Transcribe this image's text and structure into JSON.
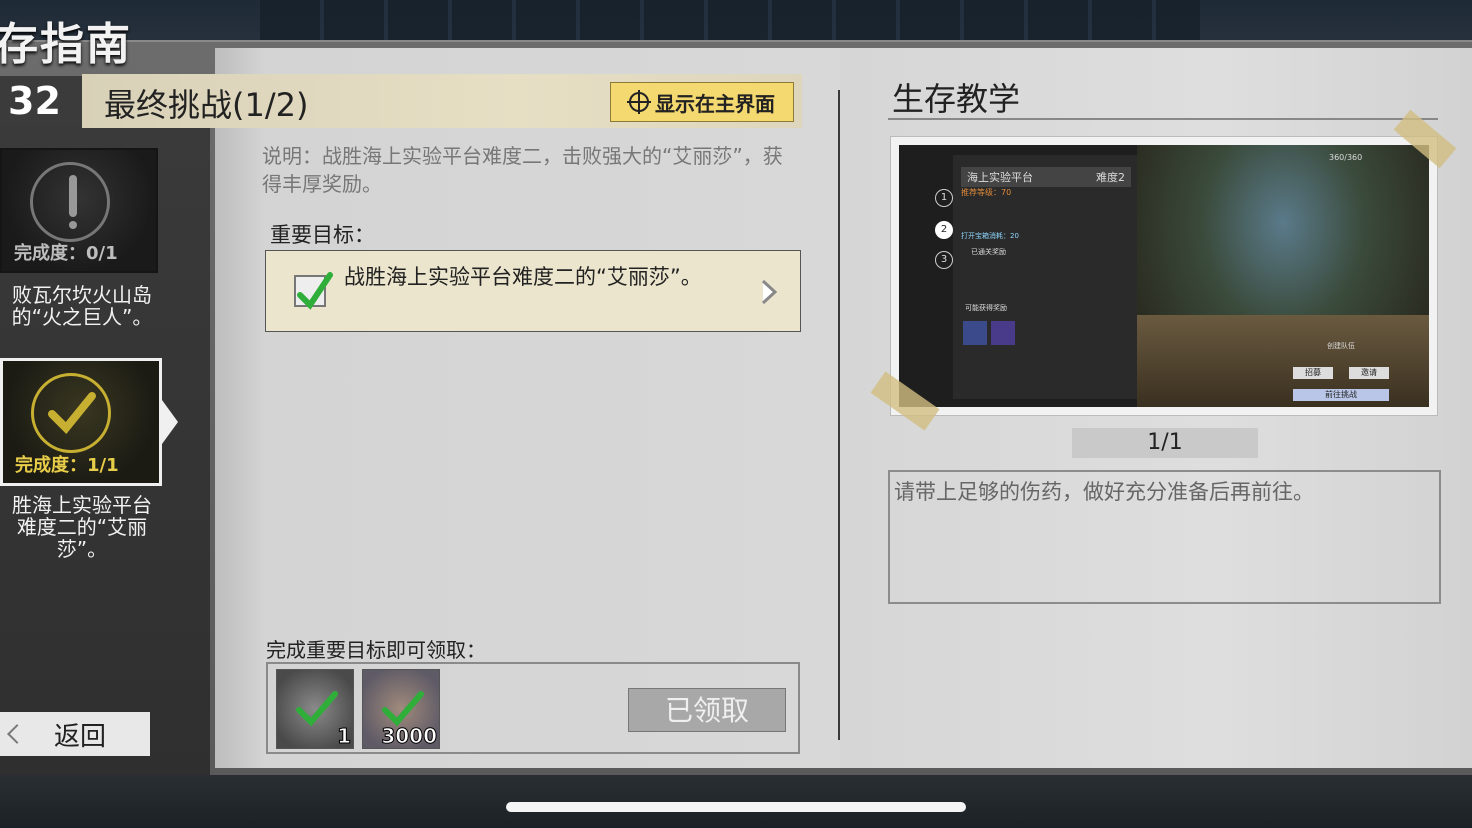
{
  "guide": {
    "title": "存指南"
  },
  "header": {
    "chapter_number": "32",
    "title": "最终挑战(1/2)",
    "show_button_label": "显示在主界面"
  },
  "sidebar": {
    "chapters": [
      {
        "progress": "完成度：0/1",
        "caption": "败瓦尔坎火山岛\n的“火之巨人”。",
        "status": "incomplete"
      },
      {
        "progress": "完成度：1/1",
        "caption": "胜海上实验平台\n难度二的“艾丽\n莎”。",
        "status": "complete"
      }
    ],
    "back_label": "返回"
  },
  "quest": {
    "description": "说明：战胜海上实验平台难度二，击败强大的“艾丽莎”，获得丰厚奖励。",
    "goal_label": "重要目标：",
    "goal_text": "战胜海上实验平台难度二的“艾丽莎”。",
    "reward_label": "完成重要目标即可领取：",
    "rewards": [
      {
        "count": "1"
      },
      {
        "count": "3000"
      }
    ],
    "claimed_label": "已领取"
  },
  "tutorial": {
    "title": "生存教学",
    "screenshot": {
      "panel_title": "海上实验平台",
      "difficulty": "难度2",
      "recommend": "推荐等级：70",
      "steps": [
        "1",
        "2",
        "3"
      ],
      "consume": "打开宝箱消耗：20",
      "reward_section": "已通关奖励",
      "possible_rewards": "可能获得奖励",
      "team_button": "创建队伍",
      "match_button": "招募",
      "invite_button": "邀请",
      "go_button": "前往挑战",
      "hp": "360/360"
    },
    "pager": "1/1",
    "tip": "请带上足够的伤药，做好充分准备后再前往。"
  },
  "colors": {
    "accent_yellow": "#f4d870",
    "complete_gold": "#e8cd49",
    "check_green": "#2fae3a"
  },
  "icons": [
    "crosshair-icon",
    "exclamation-icon",
    "check-icon",
    "chevron-right-icon",
    "back-arrow-icon"
  ]
}
